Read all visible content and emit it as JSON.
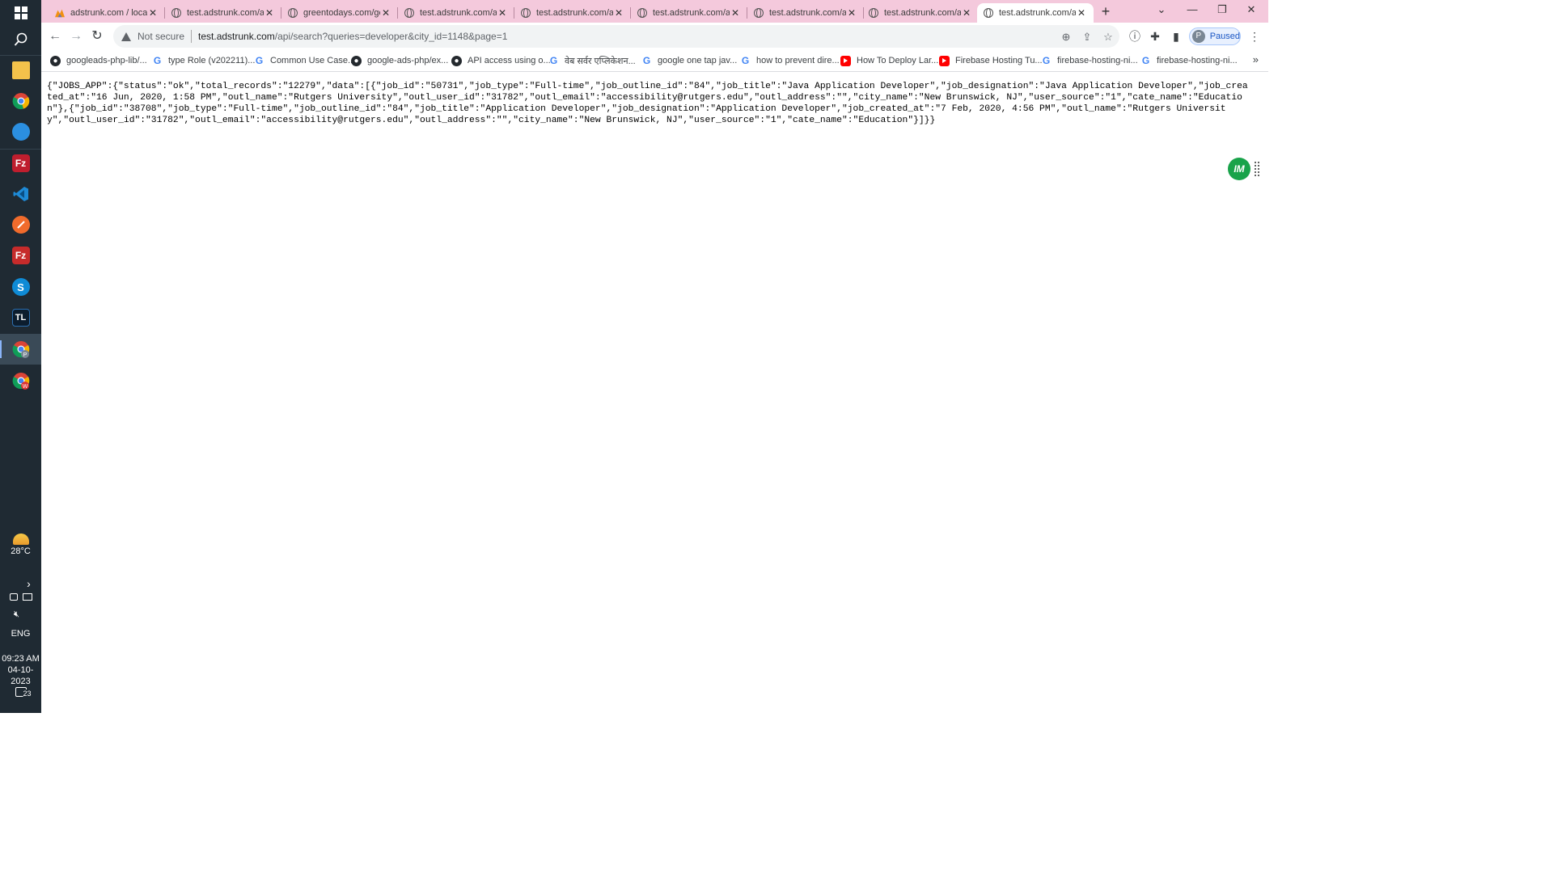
{
  "taskbar": {
    "apps": [
      {
        "name": "file-explorer",
        "color": "#f3c24b",
        "label": ""
      },
      {
        "name": "chrome",
        "color": "#ffffff",
        "label": ""
      },
      {
        "name": "edge-like",
        "color": "#2b8fe0",
        "label": ""
      },
      {
        "name": "filezilla",
        "color": "#bf1e2e",
        "label": "Fz"
      },
      {
        "name": "vscode",
        "color": "#0a75c7",
        "label": ""
      },
      {
        "name": "postman",
        "color": "#f06b2c",
        "label": ""
      },
      {
        "name": "filezilla-2",
        "color": "#c62b2b",
        "label": "Fz"
      },
      {
        "name": "skype",
        "color": "#0f8bd6",
        "label": "S"
      },
      {
        "name": "tl-app",
        "color": "#0c1d2e",
        "label": "TL"
      },
      {
        "name": "chrome-profile-p",
        "color": "#ffffff",
        "label": ""
      },
      {
        "name": "chrome-profile-w",
        "color": "#ffffff",
        "label": ""
      }
    ],
    "weather": "28°C",
    "lang": "ENG",
    "time": "09:23 AM",
    "date": "04-10-2023",
    "notifications": "23"
  },
  "tabs": [
    {
      "title": "adstrunk.com / local",
      "active": false,
      "favicon": "phpmyadmin-icon"
    },
    {
      "title": "test.adstrunk.com/api",
      "active": false,
      "favicon": "globe-icon"
    },
    {
      "title": "greentodays.com/ge",
      "active": false,
      "favicon": "globe-icon"
    },
    {
      "title": "test.adstrunk.com/api",
      "active": false,
      "favicon": "globe-icon"
    },
    {
      "title": "test.adstrunk.com/api",
      "active": false,
      "favicon": "globe-icon"
    },
    {
      "title": "test.adstrunk.com/api",
      "active": false,
      "favicon": "globe-icon"
    },
    {
      "title": "test.adstrunk.com/api",
      "active": false,
      "favicon": "globe-icon"
    },
    {
      "title": "test.adstrunk.com/api",
      "active": false,
      "favicon": "globe-icon"
    },
    {
      "title": "test.adstrunk.com/api",
      "active": true,
      "favicon": "globe-icon"
    }
  ],
  "toolbar": {
    "not_secure": "Not secure",
    "url_host": "test.adstrunk.com",
    "url_path": "/api/search?queries=developer&city_id=1148&page=1",
    "profile_initial": "P",
    "profile_status": "Paused"
  },
  "bookmarks": [
    {
      "label": "googleads-php-lib/...",
      "icon": "github"
    },
    {
      "label": "type Role (v202211)...",
      "icon": "google"
    },
    {
      "label": "Common Use Case...",
      "icon": "google"
    },
    {
      "label": "google-ads-php/ex...",
      "icon": "github"
    },
    {
      "label": "API access using o...",
      "icon": "github"
    },
    {
      "label": "वेब सर्वर एप्लिकेशन...",
      "icon": "google"
    },
    {
      "label": "google one tap jav...",
      "icon": "google"
    },
    {
      "label": "how to prevent dire...",
      "icon": "google"
    },
    {
      "label": "How To Deploy Lar...",
      "icon": "youtube"
    },
    {
      "label": "Firebase Hosting Tu...",
      "icon": "youtube"
    },
    {
      "label": "firebase-hosting-ni...",
      "icon": "google"
    },
    {
      "label": "firebase-hosting-ni...",
      "icon": "google"
    }
  ],
  "content": {
    "json_text": "{\"JOBS_APP\":{\"status\":\"ok\",\"total_records\":\"12279\",\"data\":[{\"job_id\":\"50731\",\"job_type\":\"Full-time\",\"job_outline_id\":\"84\",\"job_title\":\"Java Application Developer\",\"job_designation\":\"Java Application Developer\",\"job_created_at\":\"16 Jun, 2020, 1:58 PM\",\"outl_name\":\"Rutgers University\",\"outl_user_id\":\"31782\",\"outl_email\":\"accessibility@rutgers.edu\",\"outl_address\":\"\",\"city_name\":\"New Brunswick, NJ\",\"user_source\":\"1\",\"cate_name\":\"Education\"},{\"job_id\":\"38708\",\"job_type\":\"Full-time\",\"job_outline_id\":\"84\",\"job_title\":\"Application Developer\",\"job_designation\":\"Application Developer\",\"job_created_at\":\"7 Feb, 2020, 4:56 PM\",\"outl_name\":\"Rutgers University\",\"outl_user_id\":\"31782\",\"outl_email\":\"accessibility@rutgers.edu\",\"outl_address\":\"\",\"city_name\":\"New Brunswick, NJ\",\"user_source\":\"1\",\"cate_name\":\"Education\"}]}}",
    "extension_badge": "IM"
  }
}
